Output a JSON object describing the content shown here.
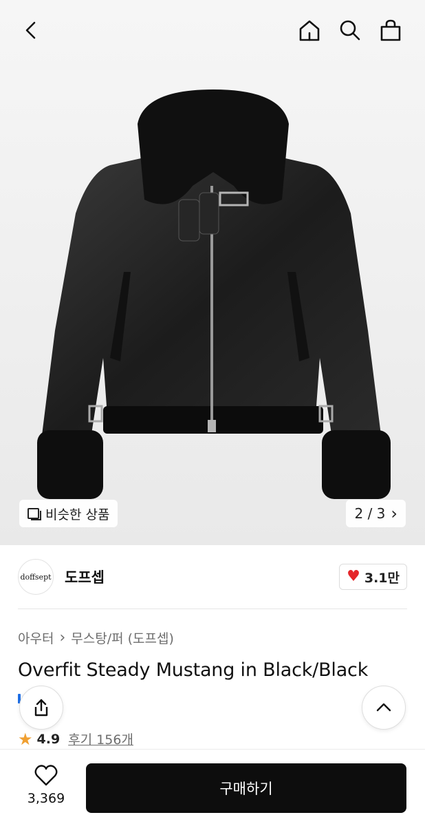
{
  "nav": {
    "icons": [
      "back-chevron-icon",
      "home-icon",
      "search-icon",
      "shopping-bag-icon"
    ]
  },
  "gallery": {
    "similar_label": "비슷한 상품",
    "pager_text": "2 / 3",
    "pager_arrow": "›"
  },
  "brand": {
    "logo_text": "doffsept",
    "name": "도프셉",
    "like_icon": "♥",
    "like_count": "3.1만",
    "like_color": "#e5262a"
  },
  "product": {
    "breadcrumb": [
      "아우터",
      "무스탕/퍼 (도프셉)"
    ],
    "breadcrumb_sep": "›",
    "title": "Overfit Steady Mustang in Black/Black",
    "rating_icon": "★",
    "rating": "4.9",
    "reviews": "후기 156개"
  },
  "bottom": {
    "wish_count": "3,369",
    "buy_label": "구매하기"
  },
  "colors": {
    "buy_button": "#0d0d0d",
    "star": "#f0a032",
    "accent_blue": "#1f6fe5"
  }
}
